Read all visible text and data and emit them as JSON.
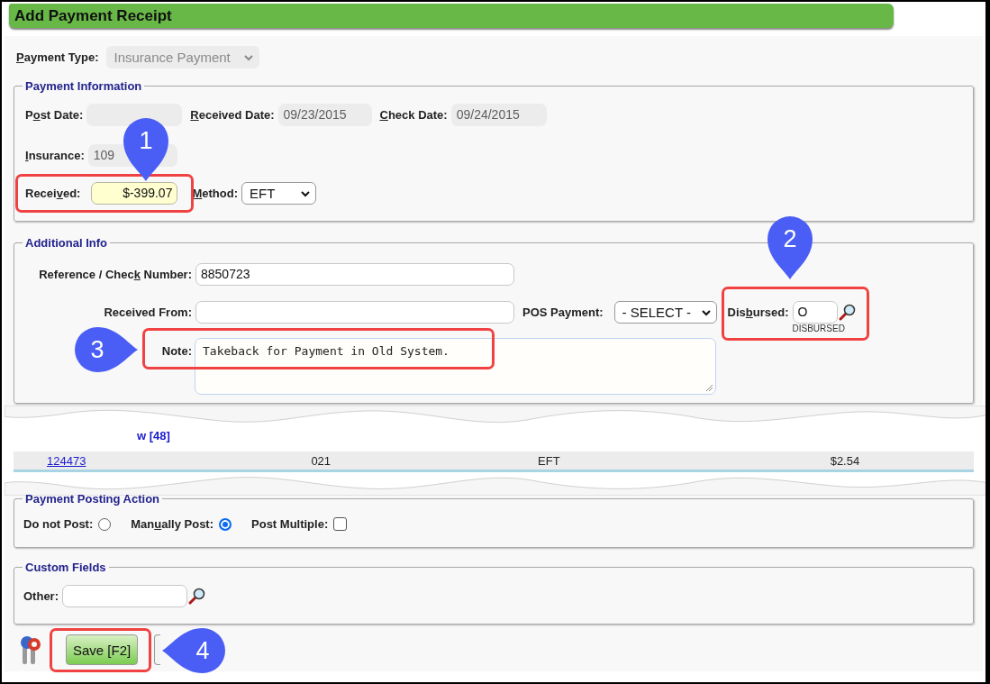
{
  "header": {
    "title": "Add Payment Receipt"
  },
  "payment_type": {
    "label": {
      "key": "P",
      "post": "ayment Type:"
    },
    "value": "Insurance Payment",
    "disabled": true
  },
  "payment_information": {
    "legend": "Payment Information",
    "fields": [
      {
        "kind": "text",
        "label": {
          "pre": "P",
          "key": "o",
          "post": "st Date:"
        },
        "disabled": true
      },
      {
        "kind": "text",
        "label": {
          "key": "R",
          "post": "eceived Date:"
        },
        "value": "09/23/2015",
        "disabled": true
      },
      {
        "kind": "text",
        "label": {
          "key": "C",
          "post": "heck Date:"
        },
        "value": "09/24/2015",
        "disabled": true
      },
      {
        "kind": "text",
        "label": {
          "key": "I",
          "post": "nsurance:"
        },
        "value": "109",
        "disabled": true
      },
      {
        "kind": "amount",
        "label": {
          "pre": "Recei",
          "key": "v",
          "post": "ed:"
        },
        "value": "$-399.07",
        "disabled": false
      },
      {
        "kind": "select",
        "label": {
          "key": "M",
          "post": "ethod:"
        },
        "value": "EFT",
        "disabled": false
      }
    ]
  },
  "additional_info": {
    "legend": "Additional Info",
    "fields": [
      {
        "kind": "text",
        "label": {
          "pre": "Reference / Chec",
          "key": "k",
          "post": " Number:"
        },
        "value": "8850723"
      },
      {
        "kind": "text",
        "label": {
          "pre": "Received From:"
        }
      },
      {
        "kind": "select",
        "label": {
          "pre": "POS Payment:"
        },
        "value": "- SELECT -"
      },
      {
        "kind": "lookup",
        "label": {
          "pre": "Dis",
          "key": "b",
          "post": "ursed:"
        },
        "value": "O",
        "caption": "DISBURSED"
      },
      {
        "kind": "textarea",
        "label": {
          "pre": "Note:"
        },
        "value": "Takeback for Payment in Old System."
      }
    ]
  },
  "table_fragment": {
    "heading": "w [48]",
    "cells": [
      {
        "kind": "link",
        "text": "124473"
      },
      {
        "kind": "text",
        "text": "021"
      },
      {
        "kind": "text",
        "text": "EFT"
      },
      {
        "kind": "text",
        "text": "$2.54"
      }
    ]
  },
  "payment_posting_action": {
    "legend": "Payment Posting Action",
    "options": [
      {
        "kind": "radio",
        "label": {
          "pre": "Do not Post:"
        },
        "selected": false
      },
      {
        "kind": "radio",
        "label": {
          "pre": "Man",
          "key": "u",
          "post": "ally Post:"
        },
        "selected": true
      },
      {
        "kind": "checkbox",
        "label": {
          "pre": "Post Multiple:"
        },
        "checked": false
      }
    ]
  },
  "custom_fields": {
    "legend": "Custom Fields",
    "fields": [
      {
        "kind": "lookup",
        "label": {
          "pre": "Other:"
        }
      }
    ]
  },
  "buttons": [
    {
      "kind": "primary",
      "label": "Save [F2]"
    },
    {
      "kind": "secondary"
    }
  ],
  "callouts": [
    {
      "number": "1",
      "kind": "down"
    },
    {
      "number": "2",
      "kind": "down"
    },
    {
      "number": "3",
      "kind": "right"
    },
    {
      "number": "4",
      "kind": "left"
    }
  ]
}
